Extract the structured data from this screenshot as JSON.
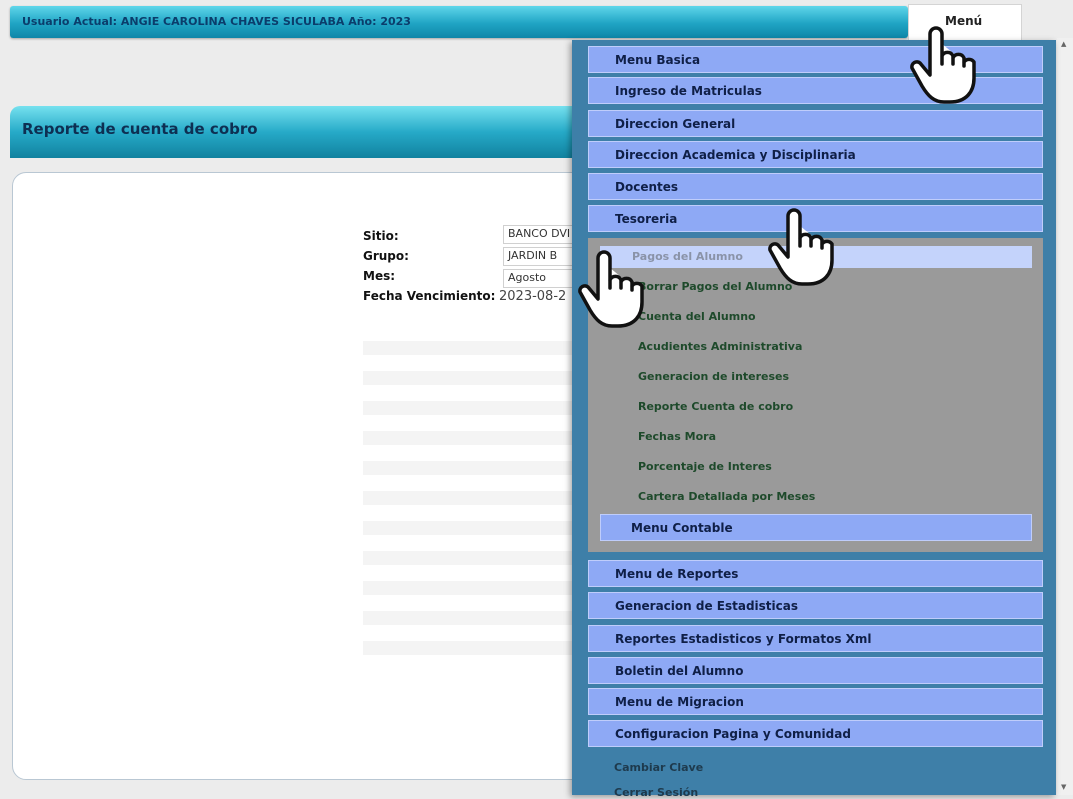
{
  "topbar": {
    "user_text": "Usuario Actual: ANGIE CAROLINA CHAVES SICULABA  Año: 2023",
    "menu_label": "Menú"
  },
  "report": {
    "title": "Reporte de cuenta de cobro"
  },
  "form": {
    "sitio_label": "Sitio:",
    "sitio_value": "BANCO DVI",
    "grupo_label": "Grupo:",
    "grupo_value": "JARDIN B",
    "mes_label": "Mes:",
    "mes_value": "Agosto",
    "fecha_label": "Fecha Vencimiento:",
    "fecha_value": "2023-08-2"
  },
  "menu": {
    "items": [
      "Menu Basica",
      "Ingreso de Matriculas",
      "Direccion General",
      "Direccion Academica y Disciplinaria",
      "Docentes",
      "Tesoreria"
    ],
    "tesoreria_submenu": [
      "Pagos del Alumno",
      "Borrar Pagos del Alumno",
      "Cuenta del Alumno",
      "Acudientes Administrativa",
      "Generacion de intereses",
      "Reporte Cuenta de cobro",
      "Fechas Mora",
      "Porcentaje de Interes",
      "Cartera Detallada por Meses"
    ],
    "menu_contable": "Menu Contable",
    "lower_items": [
      "Menu de Reportes",
      "Generacion de Estadisticas",
      "Reportes Estadisticos y Formatos Xml",
      "Boletin del Alumno",
      "Menu de Migracion",
      "Configuracion Pagina y Comunidad"
    ],
    "extra_items": [
      "Cambiar Clave",
      "Cerrar Sesión"
    ]
  },
  "colors": {
    "menu_bg": "#3e7fa8",
    "menu_item": "#8ea9f5",
    "submenu_bg": "#9a9a9a",
    "header": "#26aac8"
  },
  "icons": [
    "hand-pointer-icon"
  ]
}
